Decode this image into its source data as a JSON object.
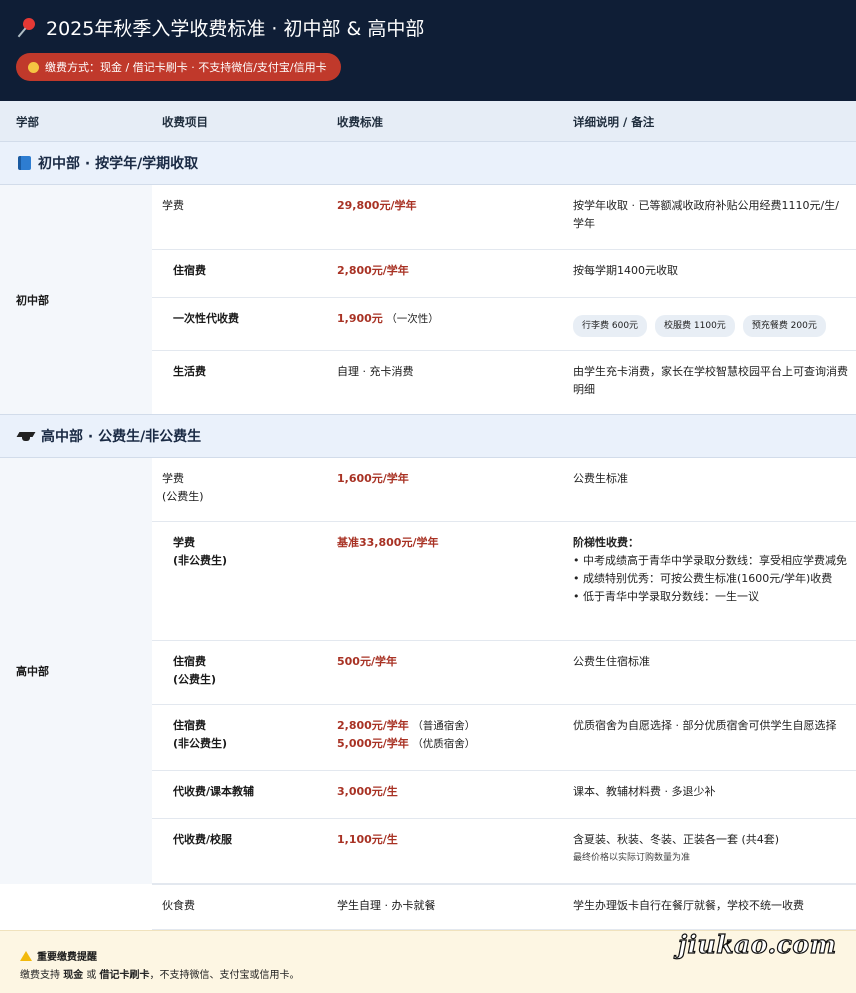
{
  "header": {
    "title": "2025年秋季入学收费标准 · 初中部 & 高中部",
    "payment_pill": "缴费方式：现金 / 借记卡刷卡 · 不支持微信/支付宝/信用卡"
  },
  "table_header": {
    "dept": "学部",
    "item": "收费项目",
    "standard": "收费标准",
    "note": "详细说明 / 备注"
  },
  "sections": {
    "junior": {
      "title": "初中部 · 按学年/学期收取",
      "dept": "初中部"
    },
    "senior": {
      "title": "高中部 · 公费生/非公费生",
      "dept": "高中部"
    }
  },
  "junior_rows": [
    {
      "item": "学费",
      "standard": "29,800元/学年",
      "note": "按学年收取 · 已等额减收政府补贴公用经费1110元/生/学年"
    },
    {
      "item": "住宿费",
      "standard": "2,800元/学年",
      "note": "按每学期1400元收取"
    },
    {
      "item": "一次性代收费",
      "standard": "1,900元",
      "standard_suffix": "（一次性）",
      "tags": [
        "行李费 600元",
        "校服费 1100元",
        "预充餐费 200元"
      ]
    },
    {
      "item": "生活费",
      "standard": "自理 · 充卡消费",
      "note": "由学生充卡消费，家长在学校智慧校园平台上可查询消费明细"
    }
  ],
  "senior_rows": [
    {
      "item_line1": "学费",
      "item_line2": "(公费生)",
      "standard": "1,600元/学年",
      "note": "公费生标准"
    },
    {
      "item_line1": "学费",
      "item_line2": "(非公费生)",
      "standard": "基准33,800元/学年",
      "note_title": "阶梯性收费：",
      "note_lines": [
        "• 中考成绩高于青华中学录取分数线：享受相应学费减免",
        "• 成绩特别优秀：可按公费生标准(1600元/学年)收费",
        "• 低于青华中学录取分数线：一生一议"
      ]
    },
    {
      "item_line1": "住宿费",
      "item_line2": "(公费生)",
      "standard": "500元/学年",
      "note": "公费生住宿标准"
    },
    {
      "item_line1": "住宿费",
      "item_line2": "(非公费生)",
      "standard_line1": "2,800元/学年",
      "standard_line1_suffix": "（普通宿舍）",
      "standard_line2": "5,000元/学年",
      "standard_line2_suffix": "（优质宿舍）",
      "note": "优质宿舍为自愿选择 · 部分优质宿舍可供学生自愿选择"
    },
    {
      "item": "代收费/课本教辅",
      "standard": "3,000元/生",
      "note": "课本、教辅材料费 · 多退少补"
    },
    {
      "item": "代收费/校服",
      "standard": "1,100元/生",
      "note": "含夏装、秋装、冬装、正装各一套 (共4套)",
      "note_small": "最终价格以实际订购数量为准"
    },
    {
      "item": "伙食费",
      "standard": "学生自理 · 办卡就餐",
      "note": "学生办理饭卡自行在餐厅就餐，学校不统一收费"
    }
  ],
  "footer": {
    "title": "重要缴费提醒",
    "text_prefix": "缴费支持 ",
    "cash": "现金",
    "or": " 或 ",
    "card": "借记卡刷卡",
    "text_suffix": "，不支持微信、支付宝或信用卡。"
  },
  "watermark": "jiukao.com"
}
